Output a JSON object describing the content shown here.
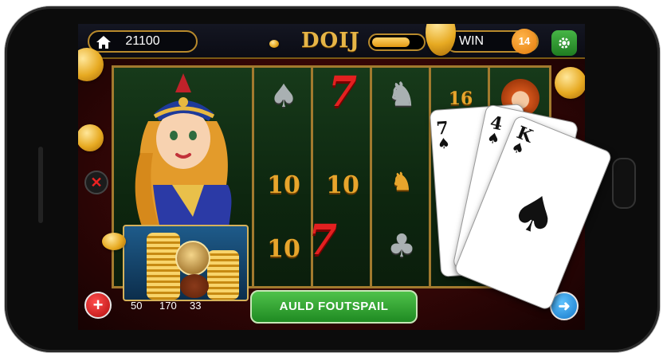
{
  "top_bar": {
    "balance": "21100",
    "logo": "DOIJ",
    "win_label": "WIN",
    "level": "14",
    "progress": 0.75
  },
  "reels": [
    {
      "symbols": [
        "♠",
        "10",
        "10"
      ]
    },
    {
      "symbols": [
        "7",
        "10",
        "7"
      ]
    },
    {
      "symbols": [
        "♞",
        "♞",
        "♣"
      ]
    },
    {
      "symbols": [
        "16",
        "",
        ""
      ]
    }
  ],
  "overlay_cards": [
    {
      "rank": "7",
      "suit": "♠"
    },
    {
      "rank": "4",
      "suit": "♠"
    },
    {
      "rank": "K",
      "suit": "♠"
    }
  ],
  "bonus_stats": [
    "50",
    "170",
    "33"
  ],
  "spin_button": "AULD FOUTSPAIL",
  "colors": {
    "gold": "#e6b547",
    "spin_green": "#2fa32e",
    "table_red": "#5a0b0b"
  }
}
